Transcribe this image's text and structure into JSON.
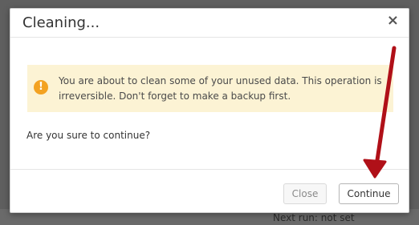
{
  "dialog": {
    "title": "Cleaning...",
    "close_glyph": "×",
    "alert_text": "You are about to clean some of your unused data. This operation is irreversible. Don't forget to make a backup first.",
    "question": "Are you sure to continue?",
    "buttons": {
      "close_label": "Close",
      "continue_label": "Continue"
    }
  },
  "background": {
    "next_run_label": "Next run:",
    "next_run_value": "not set"
  },
  "colors": {
    "warning_bg": "#fcf3d4",
    "warning_icon": "#f3a221",
    "arrow": "#b01018"
  },
  "icons": {
    "alert": "warning-circle-icon",
    "close": "close-icon"
  }
}
